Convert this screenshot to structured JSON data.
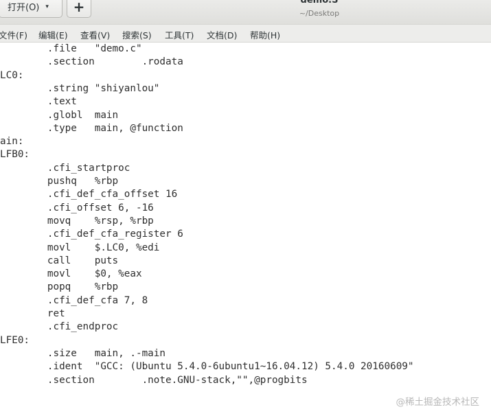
{
  "header": {
    "open_label": "打开(O)",
    "open_arrow": "▾",
    "new_label": "+",
    "title": "demo.S",
    "path": "~/Desktop"
  },
  "menu": {
    "items": [
      "文件(F)",
      "编辑(E)",
      "查看(V)",
      "搜索(S)",
      "工具(T)",
      "文档(D)",
      "帮助(H)"
    ]
  },
  "editor": {
    "lines": [
      "        .file   \"demo.c\"",
      "        .section        .rodata",
      "LC0:",
      "        .string \"shiyanlou\"",
      "        .text",
      "        .globl  main",
      "        .type   main, @function",
      "ain:",
      "LFB0:",
      "        .cfi_startproc",
      "        pushq   %rbp",
      "        .cfi_def_cfa_offset 16",
      "        .cfi_offset 6, -16",
      "        movq    %rsp, %rbp",
      "        .cfi_def_cfa_register 6",
      "        movl    $.LC0, %edi",
      "        call    puts",
      "        movl    $0, %eax",
      "        popq    %rbp",
      "        .cfi_def_cfa 7, 8",
      "        ret",
      "        .cfi_endproc",
      "LFE0:",
      "        .size   main, .-main",
      "        .ident  \"GCC: (Ubuntu 5.4.0-6ubuntu1~16.04.12) 5.4.0 20160609\"",
      "        .section        .note.GNU-stack,\"\",@progbits"
    ]
  },
  "watermark": "@稀土掘金技术社区"
}
